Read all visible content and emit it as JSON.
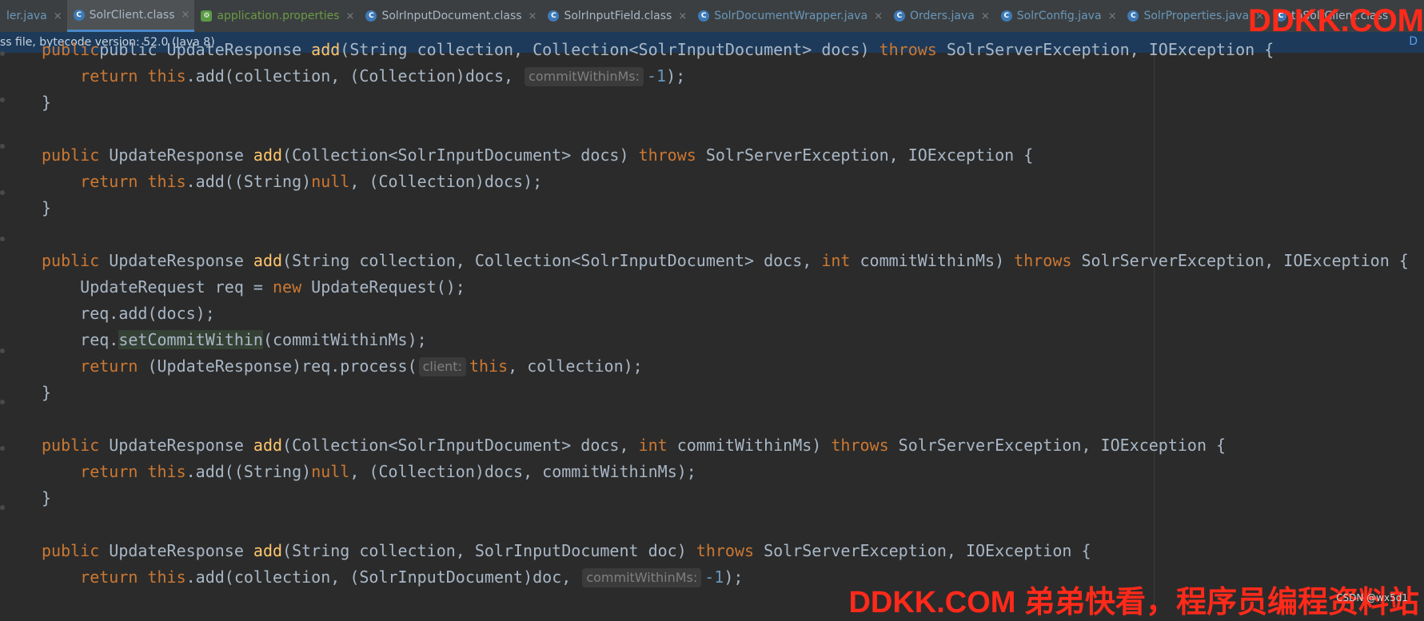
{
  "tabs": [
    {
      "label": "ler.java",
      "type": "java",
      "active": false
    },
    {
      "label": "SolrClient.class",
      "type": "class",
      "active": true
    },
    {
      "label": "application.properties",
      "type": "props",
      "active": false
    },
    {
      "label": "SolrInputDocument.class",
      "type": "class",
      "active": false
    },
    {
      "label": "SolrInputField.class",
      "type": "class",
      "active": false
    },
    {
      "label": "SolrDocumentWrapper.java",
      "type": "java",
      "active": false
    },
    {
      "label": "Orders.java",
      "type": "java",
      "active": false
    },
    {
      "label": "SolrConfig.java",
      "type": "java",
      "active": false
    },
    {
      "label": "SolrProperties.java",
      "type": "java",
      "active": false
    },
    {
      "label": "tpSolrClient.class",
      "type": "class",
      "active": false
    }
  ],
  "tab_close_glyph": "×",
  "infobar": {
    "text": "ss file, bytecode version: 52.0 (Java 8)",
    "right_link": "D"
  },
  "code": {
    "l1": {
      "a": "public UpdateResponse ",
      "fn": "add",
      "b": "(String collection, Collection<SolrInputDocument> docs) ",
      "kw": "throws",
      "c": " SolrServerException, IOException {"
    },
    "l2": {
      "ret": "return ",
      "this": "this",
      "a": ".add(collection, (Collection)docs, ",
      "hint": "commitWithinMs:",
      "num": "-1",
      "b": ");"
    },
    "brace": "}",
    "l5": {
      "pub": "public",
      "a": " UpdateResponse ",
      "fn": "add",
      "b": "(Collection<SolrInputDocument> docs) ",
      "kw": "throws",
      "c": " SolrServerException, IOException {"
    },
    "l6": {
      "ret": "return ",
      "this": "this",
      "a": ".add((String)",
      "null": "null",
      "b": ", (Collection)docs);"
    },
    "l9": {
      "pub": "public",
      "a": " UpdateResponse ",
      "fn": "add",
      "b": "(String collection, Collection<SolrInputDocument> docs, ",
      "int": "int",
      "c": " commitWithinMs) ",
      "kw": "throws",
      "d": " SolrServerException, IOException {"
    },
    "l10": {
      "a": "UpdateRequest req = ",
      "new": "new",
      "b": " UpdateRequest();"
    },
    "l11": {
      "a": "req.add(docs);"
    },
    "l12": {
      "a": "req.",
      "hl": "setCommitWithin",
      "b": "(commitWithinMs);"
    },
    "l13": {
      "ret": "return",
      "a": " (UpdateResponse)req.process(",
      "hint": "client:",
      "this": "this",
      "b": ", collection);"
    },
    "l16": {
      "pub": "public",
      "a": " UpdateResponse ",
      "fn": "add",
      "b": "(Collection<SolrInputDocument> docs, ",
      "int": "int",
      "c": " commitWithinMs) ",
      "kw": "throws",
      "d": " SolrServerException, IOException {"
    },
    "l17": {
      "ret": "return ",
      "this": "this",
      "a": ".add((String)",
      "null": "null",
      "b": ", (Collection)docs, commitWithinMs);"
    },
    "l20": {
      "pub": "public",
      "a": " UpdateResponse ",
      "fn": "add",
      "b": "(String collection, SolrInputDocument doc) ",
      "kw": "throws",
      "c": " SolrServerException, IOException {"
    },
    "l21": {
      "ret": "return ",
      "this": "this",
      "a": ".add(collection, (SolrInputDocument)doc, ",
      "hint": "commitWithinMs:",
      "num": "-1",
      "b": ");"
    }
  },
  "watermark": {
    "top": "DDKK.COM",
    "bottom": "DDKK.COM 弟弟快看，程序员编程资料站",
    "credit": "CSDN @wx5d1"
  },
  "colors": {
    "keyword": "#cc7832",
    "function": "#ffc66d",
    "number": "#6897bb",
    "text": "#a9b7c6",
    "background": "#2b2b2b",
    "watermark": "#ff2a1a"
  }
}
